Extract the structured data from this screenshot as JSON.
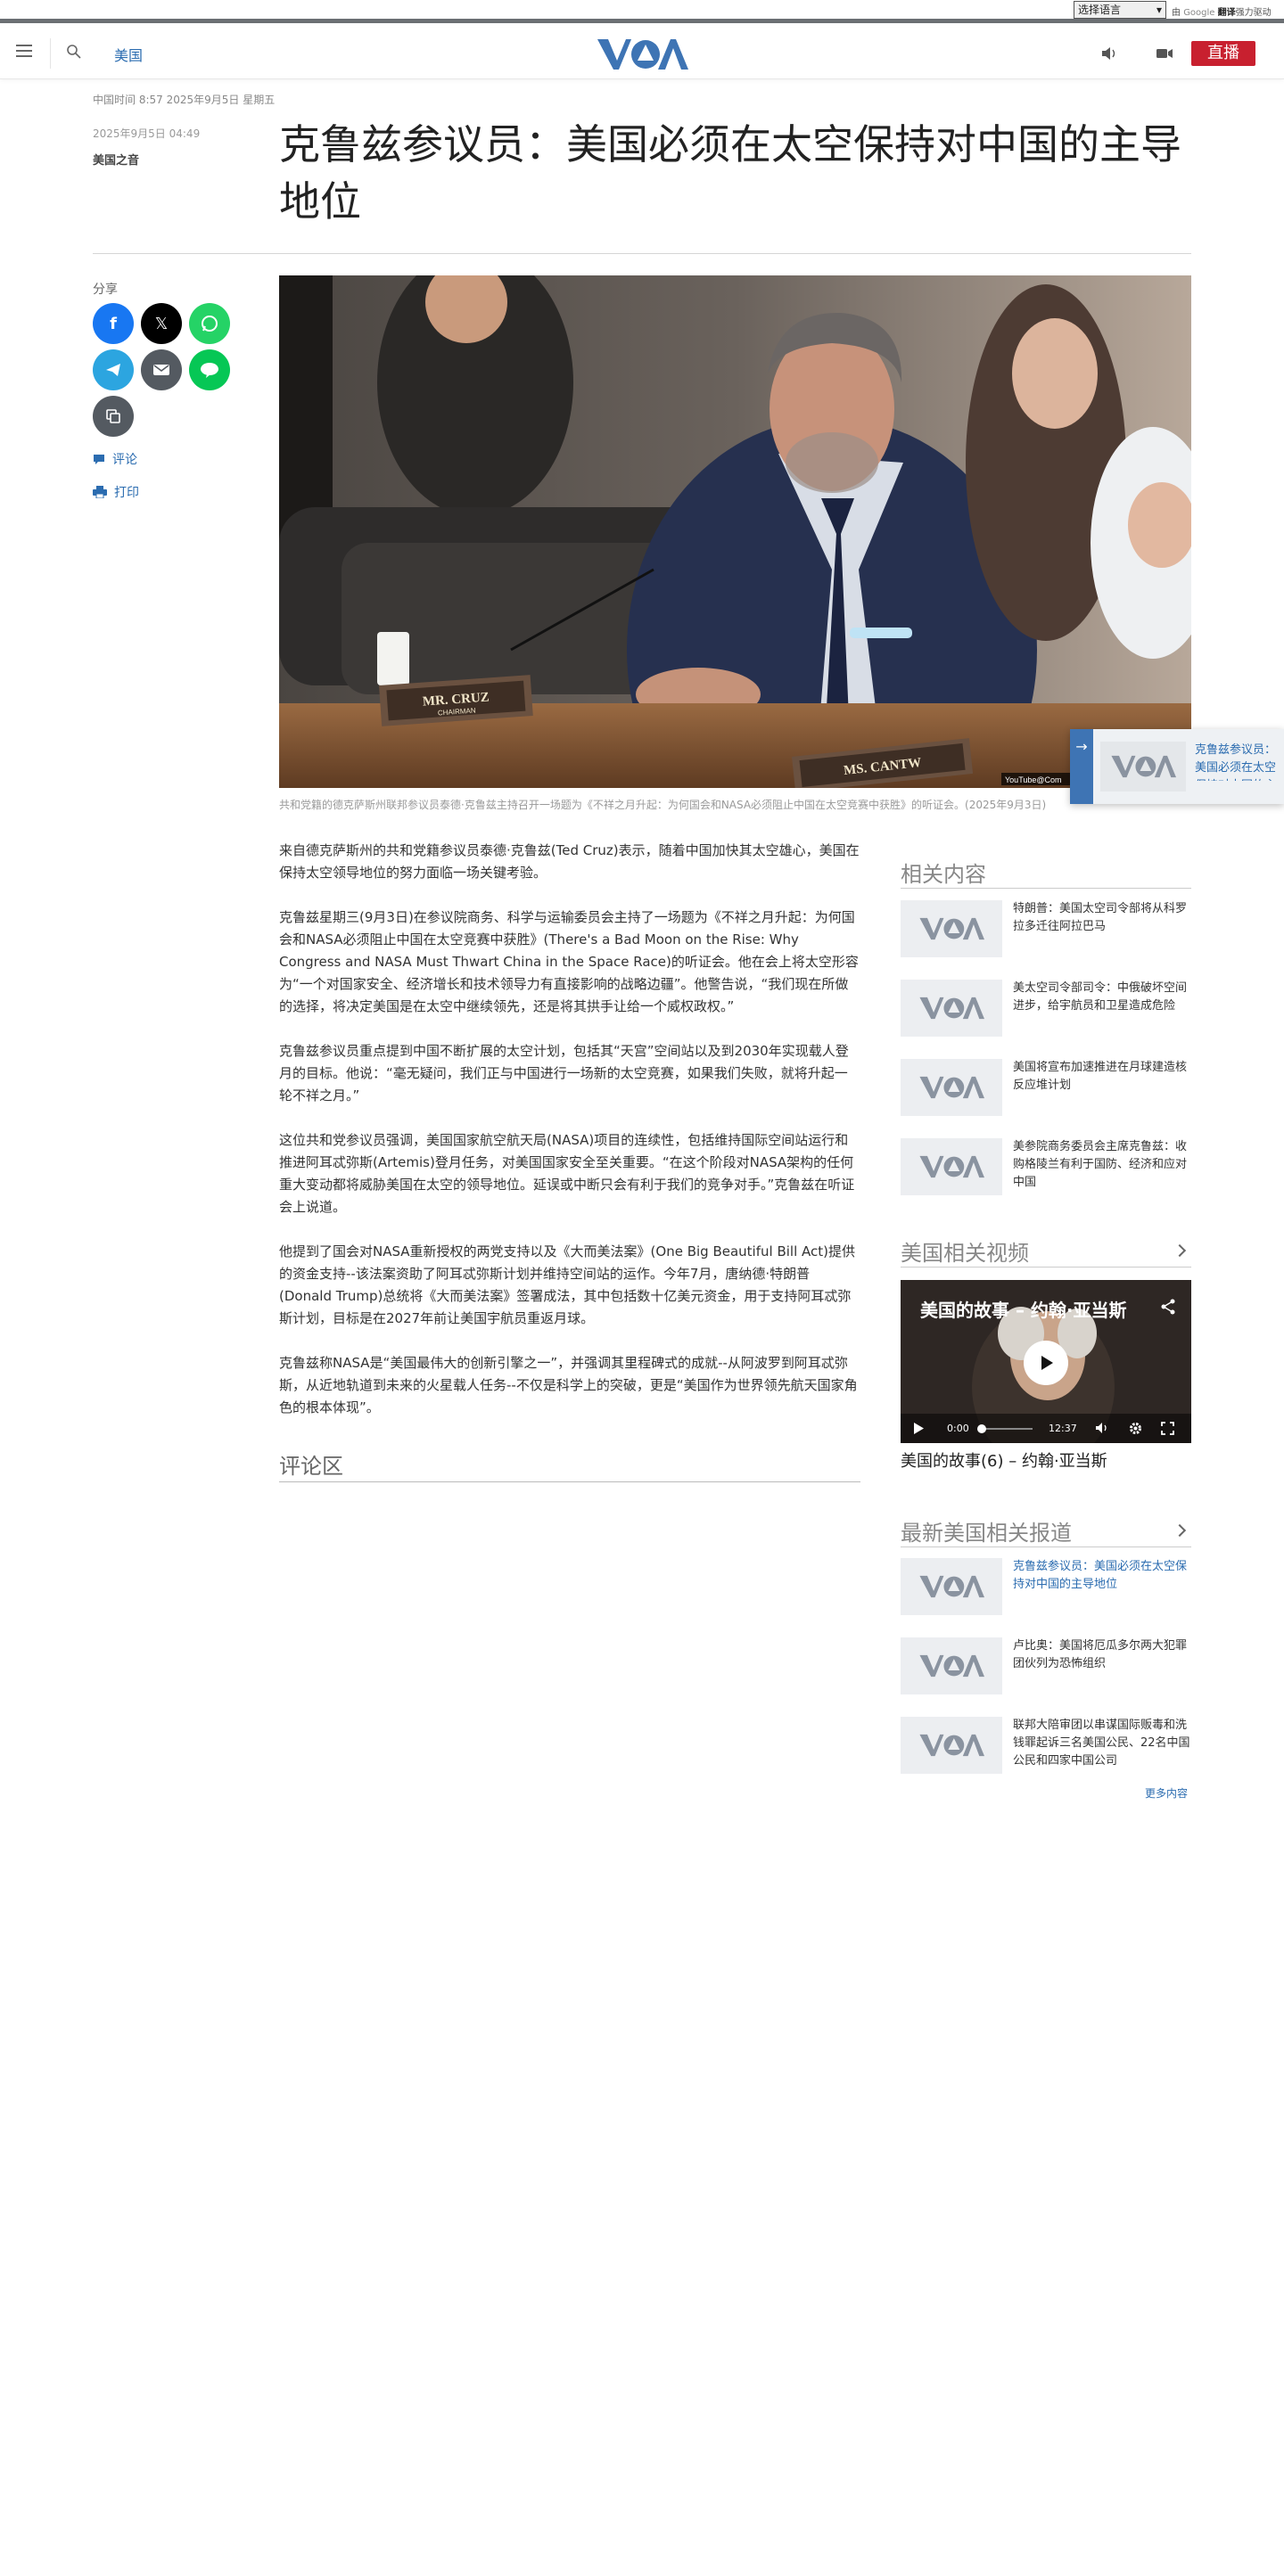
{
  "translate": {
    "select_label": "选择语言",
    "powered_by": "由",
    "google": "Google",
    "translate_word": "翻译",
    "powered_suffix": "强力驱动"
  },
  "header": {
    "section": "美国",
    "live": "直播",
    "logo_text": "VOA"
  },
  "meta": {
    "local_time": "中国时间 8:57 2025年9月5日 星期五",
    "pub_date": "2025年9月5日 04:49",
    "byline": "美国之音"
  },
  "article": {
    "title": "克鲁兹参议员：美国必须在太空保持对中国的主导地位",
    "share_label": "分享",
    "comment_label": "评论",
    "print_label": "打印",
    "image_caption": "共和党籍的德克萨斯州联邦参议员泰德·克鲁兹主持召开一场题为《不祥之月升起：为何国会和NASA必须阻止中国在太空竞赛中获胜》的听证会。(2025年9月3日)",
    "image_watermark": "YouTube@Com",
    "nameplate_1": "MR. CRUZ",
    "nameplate_1_sub": "CHAIRMAN",
    "nameplate_2": "MS. CANTW",
    "paragraphs": [
      "来自德克萨斯州的共和党籍参议员泰德·克鲁兹(Ted Cruz)表示，随着中国加快其太空雄心，美国在保持太空领导地位的努力面临一场关键考验。",
      "克鲁兹星期三(9月3日)在参议院商务、科学与运输委员会主持了一场题为《不祥之月升起：为何国会和NASA必须阻止中国在太空竞赛中获胜》(There's a Bad Moon on the Rise: Why Congress and NASA Must Thwart China in the Space Race)的听证会。他在会上将太空形容为“一个对国家安全、经济增长和技术领导力有直接影响的战略边疆”。他警告说，“我们现在所做的选择，将决定美国是在太空中继续领先，还是将其拱手让给一个威权政权。”",
      "克鲁兹参议员重点提到中国不断扩展的太空计划，包括其“天宫”空间站以及到2030年实现载人登月的目标。他说：“毫无疑问，我们正与中国进行一场新的太空竞赛，如果我们失败，就将升起一轮不祥之月。”",
      "这位共和党参议员强调，美国国家航空航天局(NASA)项目的连续性，包括维持国际空间站运行和推进阿耳忒弥斯(Artemis)登月任务，对美国国家安全至关重要。“在这个阶段对NASA架构的任何重大变动都将威胁美国在太空的领导地位。延误或中断只会有利于我们的竞争对手。”克鲁兹在听证会上说道。",
      "他提到了国会对NASA重新授权的两党支持以及《大而美法案》(One Big Beautiful Bill Act)提供的资金支持--该法案资助了阿耳忒弥斯计划并维持空间站的运作。今年7月，唐纳德·特朗普(Donald Trump)总统将《大而美法案》签署成法，其中包括数十亿美元资金，用于支持阿耳忒弥斯计划，目标是在2027年前让美国宇航员重返月球。",
      "克鲁兹称NASA是“美国最伟大的创新引擎之一”，并强调其里程碑式的成就--从阿波罗到阿耳忒弥斯，从近地轨道到未来的火星载人任务--不仅是科学上的突破，更是“美国作为世界领先航天国家角色的根本体现”。"
    ],
    "comments_title": "评论区"
  },
  "floating_card": {
    "text": "克鲁兹参议员：美国必须在太空保持对中国的主导地位"
  },
  "sidebar": {
    "related_title": "相关内容",
    "related": [
      "特朗普：美国太空司令部将从科罗拉多迁往阿拉巴马",
      "美太空司令部司令：中俄破坏空间进步，给宇航员和卫星造成危险",
      "美国将宣布加速推进在月球建造核反应堆计划",
      "美参院商务委员会主席克鲁兹：收购格陵兰有利于国防、经济和应对中国"
    ],
    "videos_title": "美国相关视频",
    "video": {
      "title": "美国的故事 – 约翰·亚当斯",
      "time_current": "0:00",
      "time_total": "12:37",
      "caption": "美国的故事(6) – 约翰·亚当斯"
    },
    "latest_title": "最新美国相关报道",
    "latest": [
      "克鲁兹参议员：美国必须在太空保持对中国的主导地位",
      "卢比奥：美国将厄瓜多尔两大犯罪团伙列为恐怖组织",
      "联邦大陪审团以串谋国际贩毒和洗钱罪起诉三名美国公民、22名中国公民和四家中国公司"
    ],
    "more": "更多内容"
  }
}
